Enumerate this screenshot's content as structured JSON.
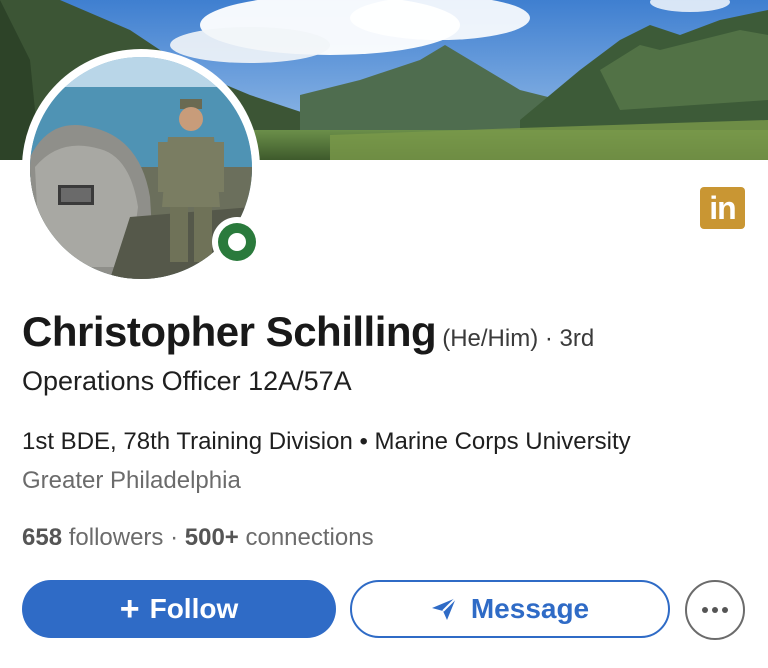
{
  "profile": {
    "name": "Christopher Schilling",
    "pronouns": "(He/Him)",
    "degree": " · 3rd",
    "headline": "Operations Officer 12A/57A",
    "affiliations": "1st BDE, 78th Training Division • Marine Corps University",
    "location": "Greater Philadelphia",
    "followers_count": "658",
    "followers_label": " followers · ",
    "connections_count": "500+",
    "connections_label": " connections",
    "linkedin_badge": "in",
    "status": "online"
  },
  "actions": {
    "follow_plus": "+",
    "follow_label": "Follow",
    "message_label": "Message",
    "more_icon": "more-icon"
  },
  "colors": {
    "primary": "#2f6bc6",
    "badge": "#c99633",
    "online": "#2a7a3c"
  }
}
